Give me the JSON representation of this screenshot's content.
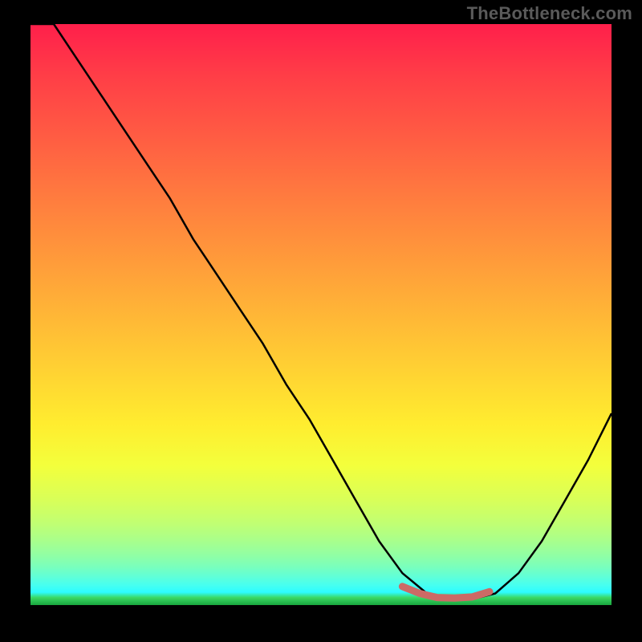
{
  "watermark": "TheBottleneck.com",
  "chart_data": {
    "type": "line",
    "title": "",
    "xlabel": "",
    "ylabel": "",
    "xlim": [
      0,
      100
    ],
    "ylim": [
      0,
      100
    ],
    "grid": false,
    "curve_color": "#000000",
    "curve_width": 2.5,
    "segment_color": "#cc6a66",
    "segment_width": 9,
    "series": [
      {
        "name": "bottleneck-curve",
        "x": [
          0,
          4,
          8,
          12,
          16,
          20,
          24,
          28,
          32,
          36,
          40,
          44,
          48,
          52,
          56,
          60,
          64,
          68,
          72,
          76,
          80,
          84,
          88,
          92,
          96,
          100
        ],
        "values": [
          100,
          100,
          94,
          88,
          82,
          76,
          70,
          63,
          57,
          51,
          45,
          38,
          32,
          25,
          18,
          11,
          5.5,
          2.2,
          1.0,
          1.0,
          2.0,
          5.5,
          11,
          18,
          25,
          33
        ]
      }
    ],
    "highlight_segment": {
      "name": "optimal-range",
      "x": [
        64,
        67,
        70,
        73,
        76,
        79
      ],
      "values": [
        3.2,
        2.0,
        1.3,
        1.2,
        1.4,
        2.3
      ]
    },
    "gradient_stops": [
      {
        "pos": 0.0,
        "color": "#ff1f4b"
      },
      {
        "pos": 0.5,
        "color": "#ffd033"
      },
      {
        "pos": 0.78,
        "color": "#f3ff3c"
      },
      {
        "pos": 0.97,
        "color": "#46fff1"
      },
      {
        "pos": 1.0,
        "color": "#18a63e"
      }
    ]
  }
}
